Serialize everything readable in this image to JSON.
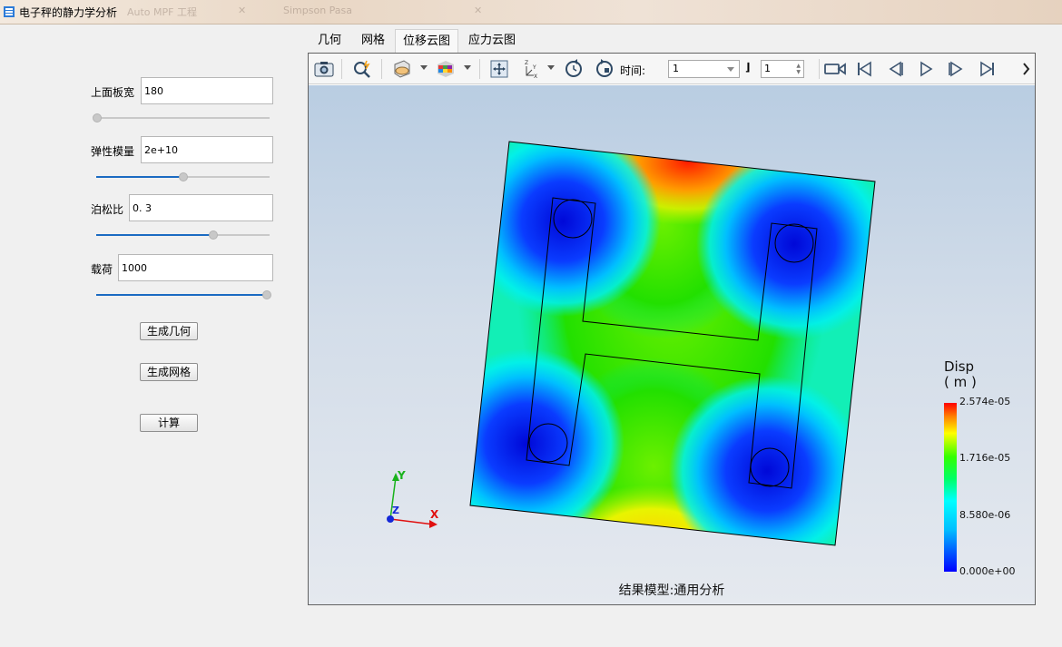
{
  "window": {
    "title": "电子秤的静力学分析",
    "ghost_tab_1": "Auto MPF 工程",
    "ghost_tab_2": "Simpson Pasa"
  },
  "params": {
    "plate_width": {
      "label": "上面板宽",
      "value": "180",
      "level": 0.0
    },
    "elastic_modulus": {
      "label": "弹性模量",
      "value": "2e+10",
      "level": 0.5
    },
    "poisson_ratio": {
      "label": "泊松比",
      "value": "0. 3",
      "level": 0.67
    },
    "load": {
      "label": "载荷",
      "value": "1000",
      "level": 1.0
    }
  },
  "buttons": {
    "gen_geometry": "生成几何",
    "gen_mesh": "生成网格",
    "compute": "计算"
  },
  "tabs": [
    {
      "label": "几何",
      "active": false
    },
    {
      "label": "网格",
      "active": false
    },
    {
      "label": "位移云图",
      "active": true
    },
    {
      "label": "应力云图",
      "active": false
    }
  ],
  "toolbar": {
    "time_label": "时间:",
    "time_value": "1",
    "step_value": "1",
    "icons": [
      "camera-icon",
      "zoom-wand-icon",
      "render-mode-icon",
      "color-cube-icon",
      "fit-view-icon",
      "axes-orient-icon",
      "rotate-ccw-icon",
      "rotate-cw-icon",
      "record-icon",
      "first-frame-icon",
      "prev-frame-icon",
      "play-icon",
      "next-frame-icon",
      "last-frame-icon"
    ]
  },
  "viewport": {
    "caption": "结果模型:通用分析",
    "axis_y": "Y",
    "axis_x": "X",
    "axis_z": "Z"
  },
  "legend": {
    "title": "Disp",
    "unit": "( m )",
    "max": "2.574e-05",
    "mid_high": "1.716e-05",
    "mid_low": "8.580e-06",
    "min": "0.000e+00"
  },
  "colors": {
    "accent": "#1b6bc2",
    "disp_high": "#ff0000",
    "disp_mid": "#00ff00",
    "disp_low": "#0000ff"
  }
}
